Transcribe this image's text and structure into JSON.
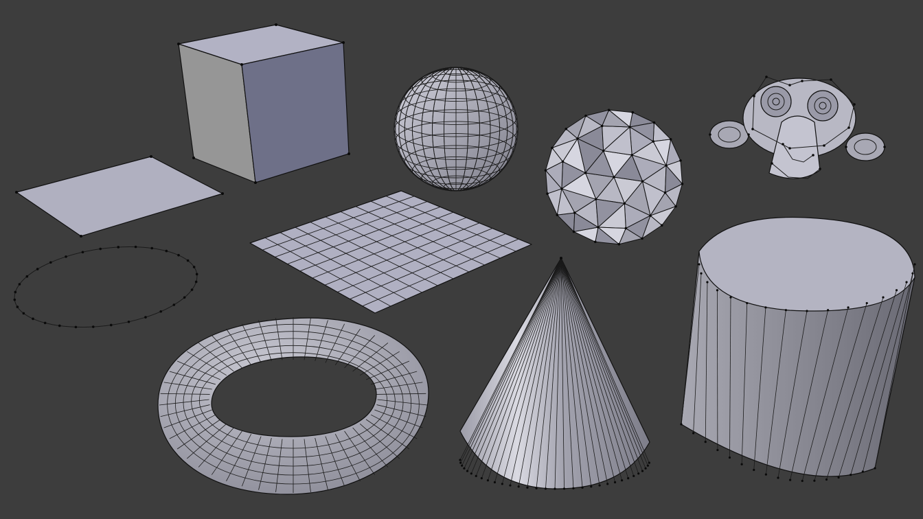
{
  "viewport": {
    "background": "#3d3d3d",
    "wire_color": "#1a1a1a",
    "vertex_color": "#0a0a0a",
    "face_light": "#c8c8d2",
    "face_mid": "#9a9aa8",
    "face_dark": "#6e7088"
  },
  "primitives": [
    {
      "kind": "plane",
      "icon": "plane-mesh-icon"
    },
    {
      "kind": "cube",
      "icon": "cube-mesh-icon"
    },
    {
      "kind": "circle",
      "icon": "circle-mesh-icon",
      "vertices": 32
    },
    {
      "kind": "uv-sphere",
      "icon": "uv-sphere-mesh-icon",
      "segments": 32,
      "rings": 16
    },
    {
      "kind": "icosphere",
      "icon": "icosphere-mesh-icon"
    },
    {
      "kind": "grid",
      "icon": "grid-mesh-icon",
      "subdivisions": 10
    },
    {
      "kind": "monkey",
      "icon": "monkey-mesh-icon"
    },
    {
      "kind": "torus",
      "icon": "torus-mesh-icon",
      "major_segments": 48,
      "minor_segments": 12
    },
    {
      "kind": "cone",
      "icon": "cone-mesh-icon",
      "vertices": 32
    },
    {
      "kind": "cylinder",
      "icon": "cylinder-mesh-icon",
      "vertices": 32
    }
  ]
}
